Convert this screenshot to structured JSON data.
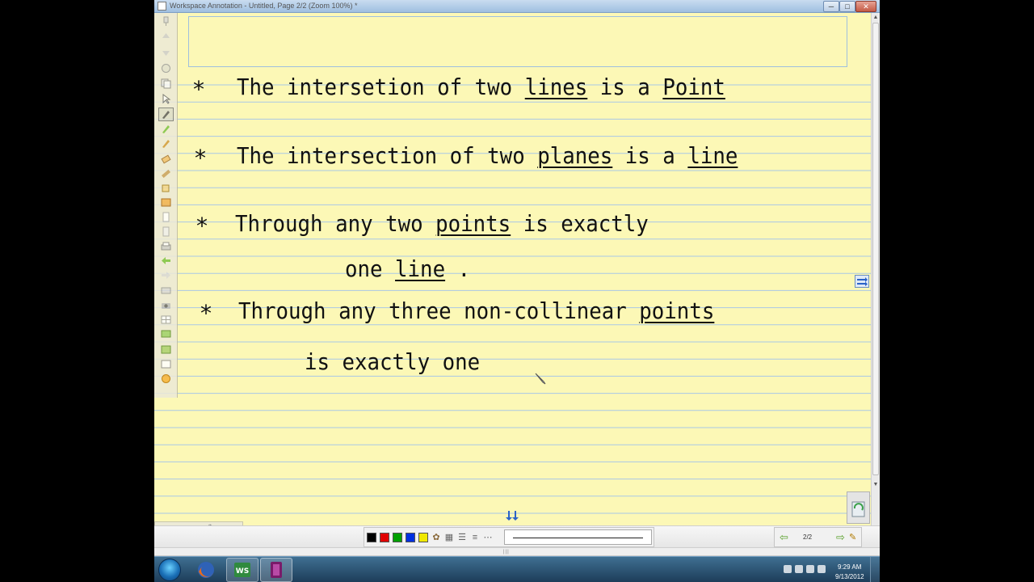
{
  "window": {
    "title": "Workspace Annotation - Untitled, Page 2/2  (Zoom 100%) *",
    "minimize_glyph": "─",
    "maximize_glyph": "□",
    "close_glyph": "✕"
  },
  "notes": {
    "bullet_glyph": "*",
    "lines": [
      {
        "bullet": true,
        "text_before": "The  intersetion  of  two  ",
        "underlined": "lines",
        "text_after": "  is a ",
        "underlined_2": "Point"
      },
      {
        "bullet": true,
        "text_before": "The  intersection  of  two  ",
        "underlined": "planes",
        "text_after": " is a ",
        "underlined_2": "line"
      },
      {
        "bullet": true,
        "text_before": "Through  any   two  ",
        "underlined": "points",
        "text_after": "  is  exactly",
        "underlined_2": ""
      },
      {
        "bullet": false,
        "text_before": "one  ",
        "underlined": "line",
        "text_after": " .",
        "underlined_2": ""
      },
      {
        "bullet": true,
        "text_before": "Through  any   three  non-collinear ",
        "underlined": "points",
        "text_after": "",
        "underlined_2": ""
      },
      {
        "bullet": false,
        "text_before": "is  exactly  one",
        "underlined": "",
        "text_after": "",
        "underlined_2": ""
      }
    ]
  },
  "pagebar": {
    "add_glyph": "+",
    "remove_glyph": "−",
    "edit_glyph": "✎",
    "copy_glyph": "⧉"
  },
  "toolbar": {
    "colors": [
      "#000000",
      "#e00000",
      "#00a000",
      "#0030e0",
      "#f0e800"
    ],
    "page_indicator": "2/2",
    "prev_glyph": "⇦",
    "next_glyph": "⇨",
    "nav_extra_glyph": "✎"
  },
  "taskbar": {
    "workspace_label": "WS",
    "time": "9:29 AM",
    "date": "9/13/2012"
  }
}
